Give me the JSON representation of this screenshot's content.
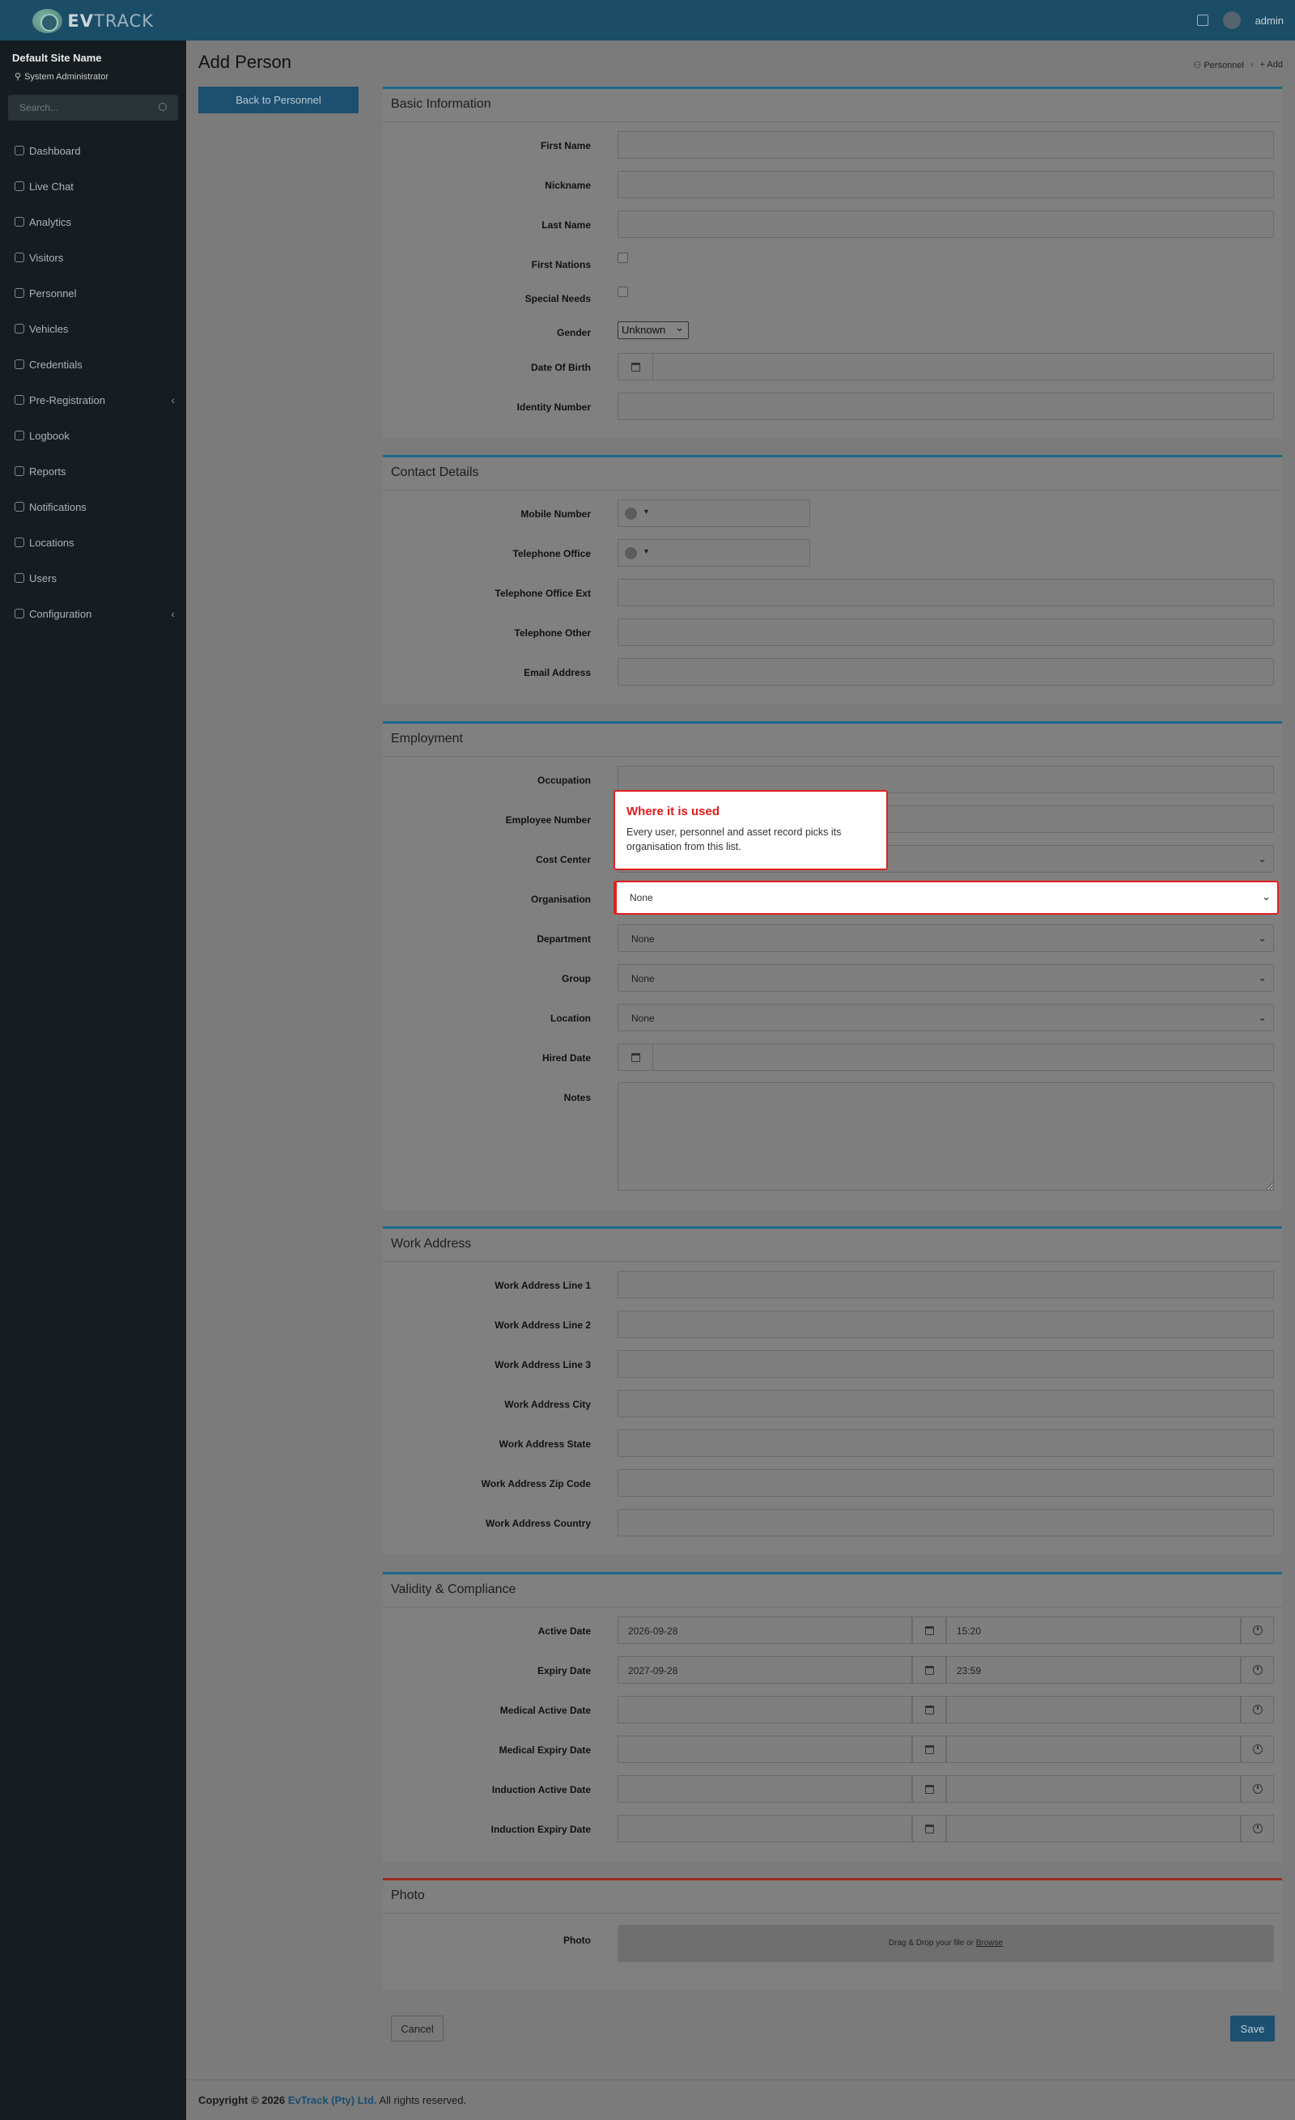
{
  "app": {
    "logo_text": "EVTRACK",
    "logo_brand": "EV",
    "logo_rest": "TRACK"
  },
  "topbar": {
    "user": "admin"
  },
  "sidebar": {
    "site_name": "Default Site Name",
    "role": "System Administrator",
    "search_placeholder": "Search...",
    "items": [
      {
        "label": "Dashboard",
        "icon": "dashboard-icon"
      },
      {
        "label": "Live Chat",
        "icon": "headset-icon"
      },
      {
        "label": "Analytics",
        "icon": "target-icon"
      },
      {
        "label": "Visitors",
        "icon": "eye-icon"
      },
      {
        "label": "Personnel",
        "icon": "user-plus-icon"
      },
      {
        "label": "Vehicles",
        "icon": "bus-icon"
      },
      {
        "label": "Credentials",
        "icon": "id-card-icon"
      },
      {
        "label": "Pre-Registration",
        "icon": "link-icon",
        "expandable": true
      },
      {
        "label": "Logbook",
        "icon": "book-icon"
      },
      {
        "label": "Reports",
        "icon": "chart-icon"
      },
      {
        "label": "Notifications",
        "icon": "mail-icon"
      },
      {
        "label": "Locations",
        "icon": "building-icon"
      },
      {
        "label": "Users",
        "icon": "users-icon"
      },
      {
        "label": "Configuration",
        "icon": "gear-icon",
        "expandable": true
      }
    ]
  },
  "page": {
    "title": "Add Person",
    "breadcrumb_1": "Personnel",
    "breadcrumb_2": "Add",
    "back_label": "Back to Personnel"
  },
  "basic": {
    "title": "Basic Information",
    "first_name": "First Name",
    "nickname": "Nickname",
    "last_name": "Last Name",
    "first_nations": "First Nations",
    "special_needs": "Special Needs",
    "gender": "Gender",
    "gender_value": "Unknown",
    "dob": "Date Of Birth",
    "identity": "Identity Number"
  },
  "contact": {
    "title": "Contact Details",
    "mobile": "Mobile Number",
    "tel_office": "Telephone Office",
    "tel_office_ext": "Telephone Office Ext",
    "tel_other": "Telephone Other",
    "email": "Email Address"
  },
  "employment": {
    "title": "Employment",
    "occupation": "Occupation",
    "employee_number": "Employee Number",
    "cost_center": "Cost Center",
    "organisation": "Organisation",
    "organisation_value": "None",
    "department": "Department",
    "department_value": "None",
    "group": "Group",
    "group_value": "None",
    "location": "Location",
    "location_value": "None",
    "hired_date": "Hired Date",
    "notes": "Notes"
  },
  "tooltip": {
    "title": "Where it is used",
    "body": "Every user, personnel and asset record picks its organisation from this list."
  },
  "work": {
    "title": "Work Address",
    "line1": "Work Address Line 1",
    "line2": "Work Address Line 2",
    "line3": "Work Address Line 3",
    "city": "Work Address City",
    "state": "Work Address State",
    "zip": "Work Address Zip Code",
    "country": "Work Address Country"
  },
  "validity": {
    "title": "Validity & Compliance",
    "active": "Active Date",
    "active_date": "2026-09-28",
    "active_time": "15:20",
    "expiry": "Expiry Date",
    "expiry_date": "2027-09-28",
    "expiry_time": "23:59",
    "med_active": "Medical Active Date",
    "med_expiry": "Medical Expiry Date",
    "ind_active": "Induction Active Date",
    "ind_expiry": "Induction Expiry Date"
  },
  "photo": {
    "title": "Photo",
    "label": "Photo",
    "drop_text": "Drag & Drop your file or",
    "browse": "Browse"
  },
  "actions": {
    "cancel": "Cancel",
    "save": "Save"
  },
  "footer": {
    "prefix": "Copyright © 2026",
    "company": "EvTrack (Pty) Ltd.",
    "suffix": "All rights reserved."
  }
}
